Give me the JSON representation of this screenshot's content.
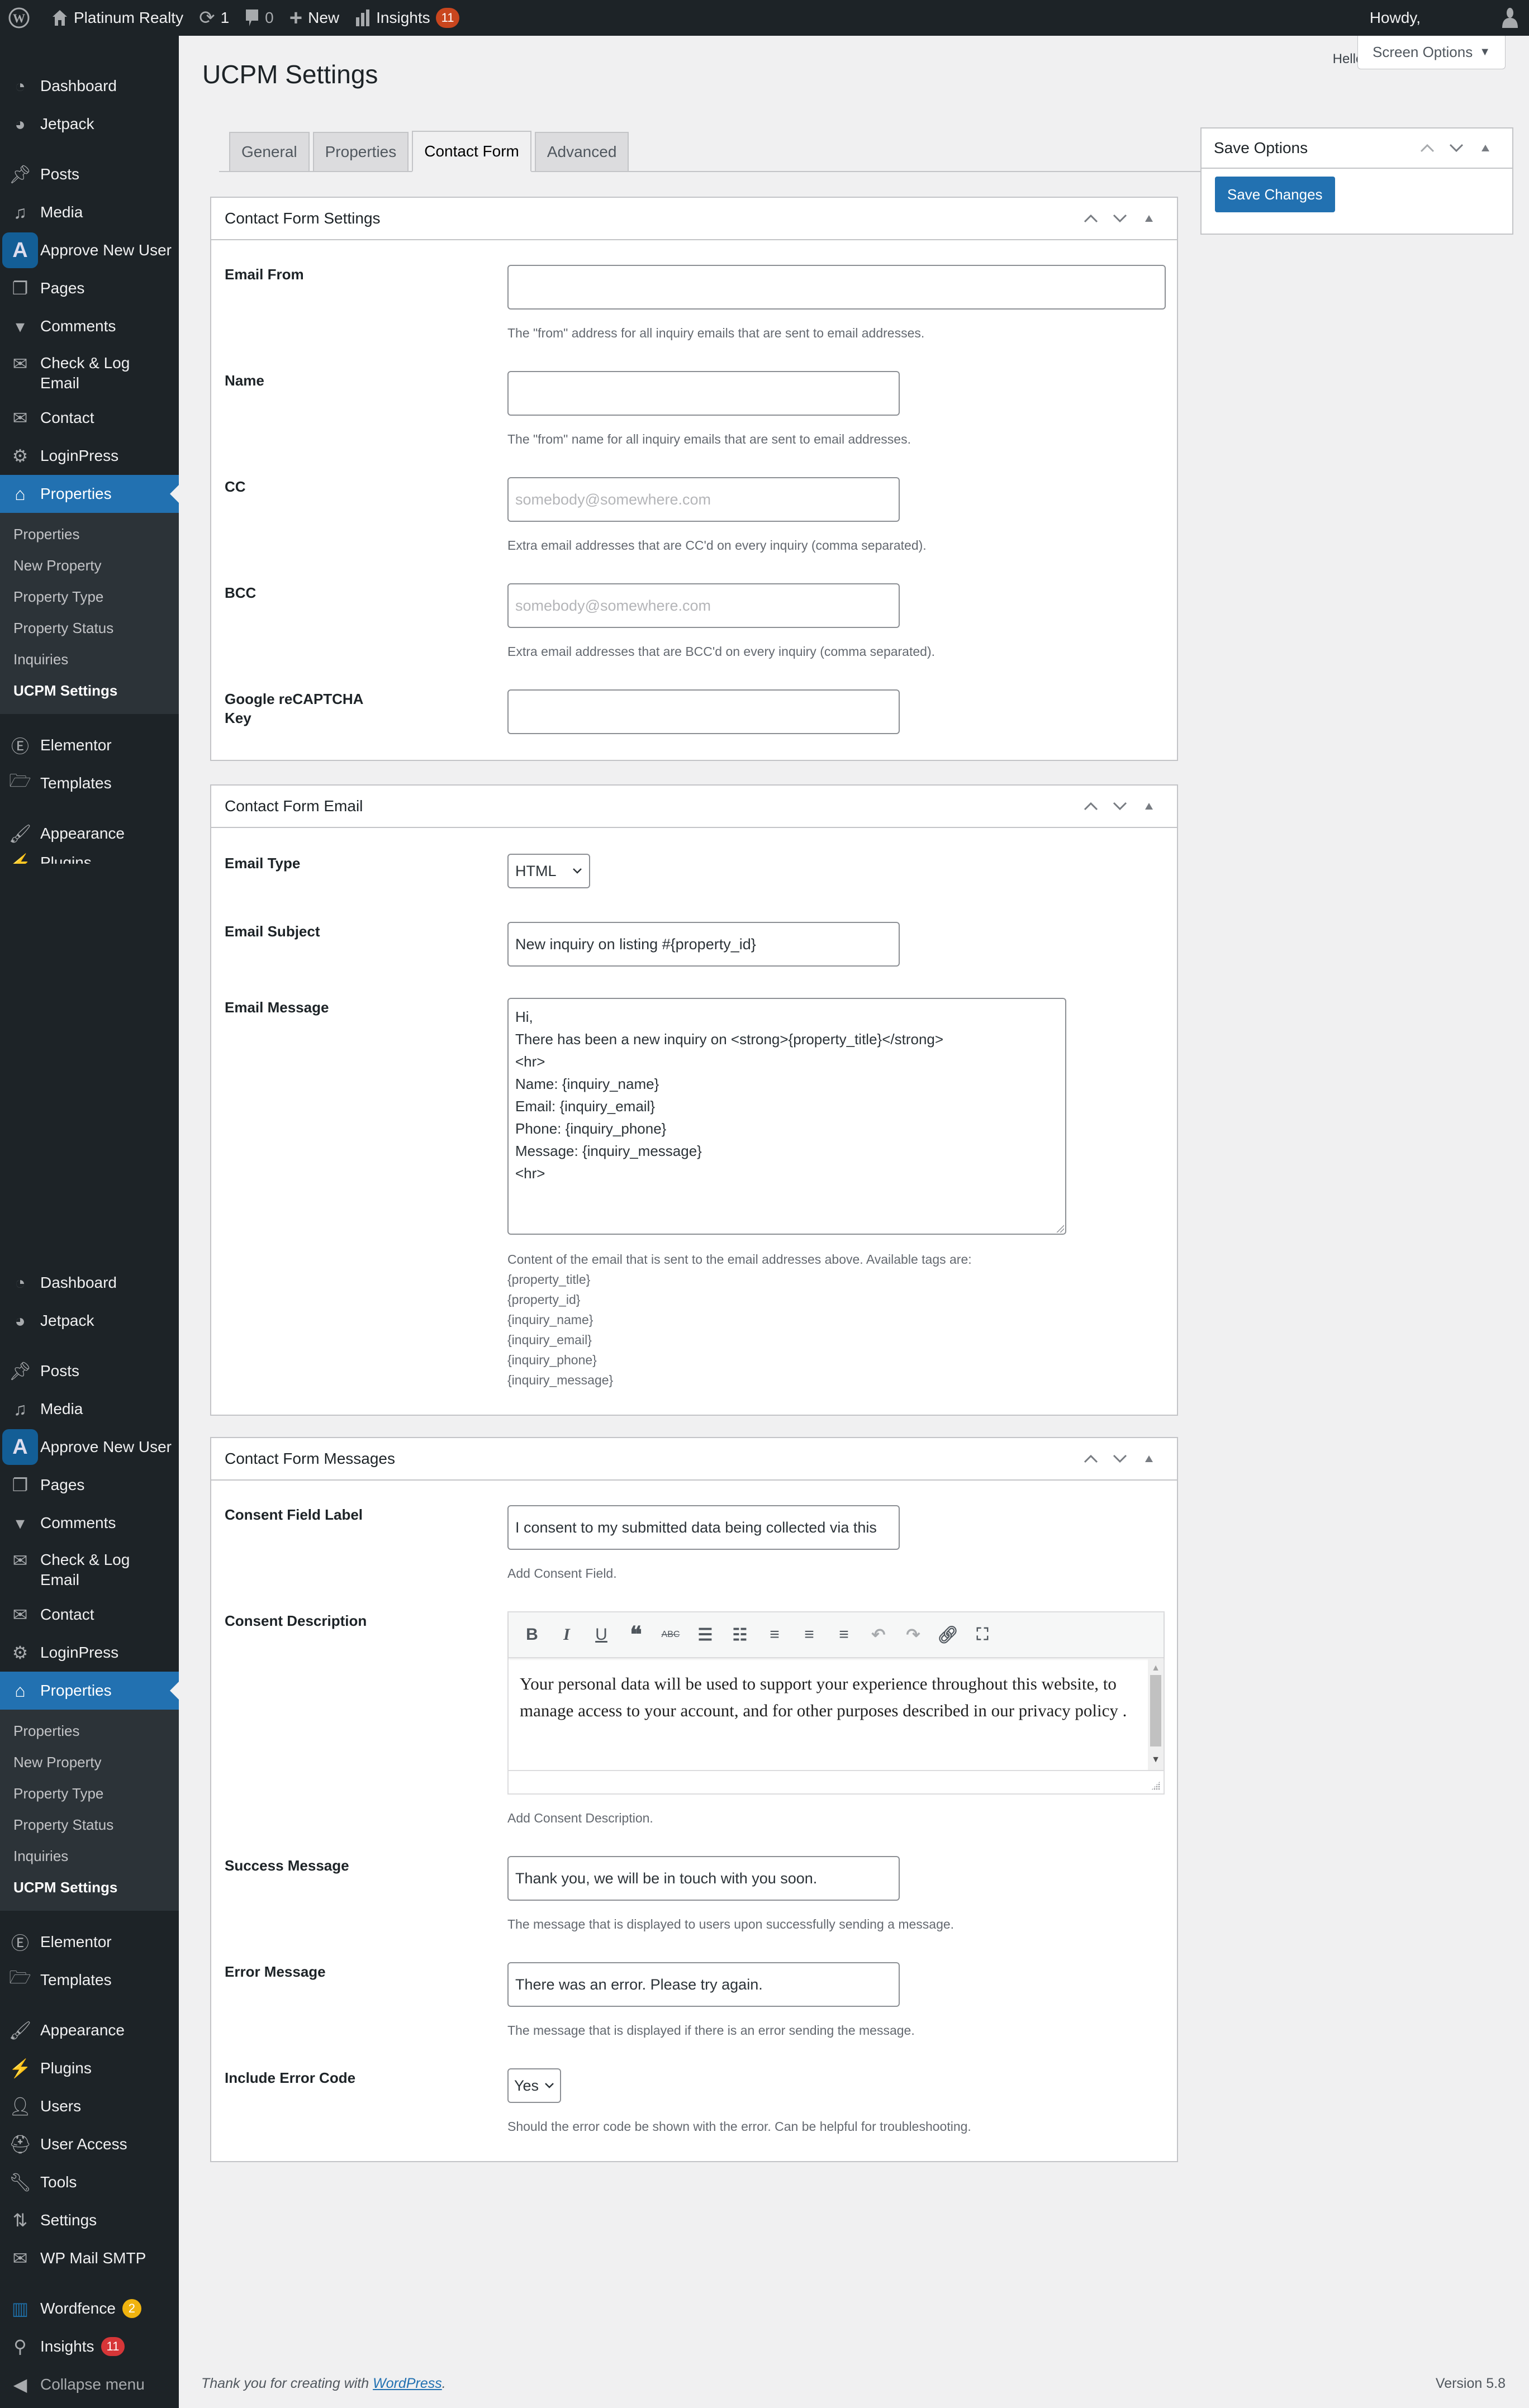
{
  "admin_bar": {
    "site_name": "Platinum Realty",
    "updates_count": "1",
    "comments_count": "0",
    "new_label": "New",
    "insights_label": "Insights",
    "insights_badge": "11",
    "howdy": "Howdy,"
  },
  "sidebar_top": {
    "items": [
      {
        "label": "Dashboard",
        "icon": "dashboard-icon"
      },
      {
        "label": "Jetpack",
        "icon": "jetpack-icon"
      },
      {
        "label": "Posts",
        "icon": "pin-icon"
      },
      {
        "label": "Media",
        "icon": "media-icon"
      },
      {
        "label": "Approve New User",
        "icon": "approve-user-icon"
      },
      {
        "label": "Pages",
        "icon": "pages-icon"
      },
      {
        "label": "Comments",
        "icon": "comment-icon"
      },
      {
        "label": "Check & Log Email",
        "icon": "envelope-open-icon"
      },
      {
        "label": "Contact",
        "icon": "envelope-icon"
      },
      {
        "label": "LoginPress",
        "icon": "loginpress-icon"
      },
      {
        "label": "Properties",
        "icon": "houses-icon"
      }
    ],
    "submenu": [
      "Properties",
      "New Property",
      "Property Type",
      "Property Status",
      "Inquiries",
      "UCPM Settings"
    ],
    "after": [
      {
        "label": "Elementor",
        "icon": "elementor-icon"
      },
      {
        "label": "Templates",
        "icon": "folder-icon"
      },
      {
        "label": "Appearance",
        "icon": "paintbrush-icon"
      },
      {
        "label": "Plugins",
        "icon": "plugin-icon"
      }
    ]
  },
  "sidebar_bottom": {
    "items": [
      {
        "label": "Dashboard"
      },
      {
        "label": "Jetpack"
      },
      {
        "label": "Posts"
      },
      {
        "label": "Media"
      },
      {
        "label": "Approve New User"
      },
      {
        "label": "Pages"
      },
      {
        "label": "Comments"
      },
      {
        "label": "Check & Log Email"
      },
      {
        "label": "Contact"
      },
      {
        "label": "LoginPress"
      },
      {
        "label": "Properties"
      }
    ],
    "submenu": [
      "Properties",
      "New Property",
      "Property Type",
      "Property Status",
      "Inquiries",
      "UCPM Settings"
    ],
    "after": [
      {
        "label": "Elementor"
      },
      {
        "label": "Templates"
      },
      {
        "label": "Appearance"
      },
      {
        "label": "Plugins"
      },
      {
        "label": "Users"
      },
      {
        "label": "User Access"
      },
      {
        "label": "Tools"
      },
      {
        "label": "Settings"
      },
      {
        "label": "WP Mail SMTP"
      },
      {
        "label": "Wordfence",
        "badge": "2"
      },
      {
        "label": "Insights",
        "badge": "11"
      },
      {
        "label": "Collapse menu"
      }
    ]
  },
  "header": {
    "page_title": "UCPM Settings",
    "hello": "Hello, Dolly",
    "screen_options": "Screen Options"
  },
  "tabs": [
    {
      "label": "General",
      "active": false
    },
    {
      "label": "Properties",
      "active": false
    },
    {
      "label": "Contact Form",
      "active": true
    },
    {
      "label": "Advanced",
      "active": false
    }
  ],
  "settings_box": {
    "title": "Contact Form Settings",
    "fields": {
      "email_from": {
        "label": "Email From",
        "value": "",
        "desc": "The \"from\" address for all inquiry emails that are sent to email addresses."
      },
      "name": {
        "label": "Name",
        "value": "",
        "desc": "The \"from\" name for all inquiry emails that are sent to email addresses."
      },
      "cc": {
        "label": "CC",
        "placeholder": "somebody@somewhere.com",
        "desc": "Extra email addresses that are CC'd on every inquiry (comma separated)."
      },
      "bcc": {
        "label": "BCC",
        "placeholder": "somebody@somewhere.com",
        "desc": "Extra email addresses that are BCC'd on every inquiry (comma separated)."
      },
      "recaptcha": {
        "label": "Google reCAPTCHA Key",
        "value": ""
      }
    }
  },
  "email_box": {
    "title": "Contact Form Email",
    "email_type": {
      "label": "Email Type",
      "value": "HTML"
    },
    "email_subject": {
      "label": "Email Subject",
      "value": "New inquiry on listing #{property_id}"
    },
    "email_message": {
      "label": "Email Message",
      "lines": [
        "Hi,",
        "There has been a new inquiry on <strong>{property_title}</strong>",
        "<hr>",
        "Name: {inquiry_name}",
        "Email: {inquiry_email}",
        "Phone: {inquiry_phone}",
        "Message: {inquiry_message}",
        "<hr>"
      ],
      "desc": "Content of the email that is sent to the email addresses above. Available tags are:",
      "tags": [
        "{property_title}",
        "{property_id}",
        "{inquiry_name}",
        "{inquiry_email}",
        "{inquiry_phone}",
        "{inquiry_message}"
      ]
    }
  },
  "messages_box": {
    "title": "Contact Form Messages",
    "consent_label": {
      "label": "Consent Field Label",
      "value": "I consent to my submitted data being collected via this",
      "desc": "Add Consent Field."
    },
    "consent_desc": {
      "label": "Consent Description",
      "text": "Your personal data will be used to support your experience throughout this website, to manage access to your account, and for other purposes described in our privacy policy .",
      "desc": "Add Consent Description.",
      "toolbar": [
        "bold",
        "italic",
        "underline",
        "blockquote",
        "strikethrough",
        "bullet-list",
        "numbered-list",
        "align-left",
        "align-center",
        "align-right",
        "undo",
        "redo",
        "link",
        "fullscreen"
      ]
    },
    "success": {
      "label": "Success Message",
      "value": "Thank you, we will be in touch with you soon.",
      "desc": "The message that is displayed to users upon successfully sending a message."
    },
    "error": {
      "label": "Error Message",
      "value": "There was an error. Please try again.",
      "desc": "The message that is displayed if there is an error sending the message."
    },
    "error_code": {
      "label": "Include Error Code",
      "value": "Yes",
      "desc": "Should the error code be shown with the error. Can be helpful for troubleshooting."
    }
  },
  "save_box": {
    "title": "Save Options",
    "button": "Save Changes"
  },
  "footer": {
    "thanks": "Thank you for creating with ",
    "link": "WordPress",
    "version": "Version 5.8"
  },
  "colors": {
    "accent": "#2271b1",
    "adminbar": "#1d2327",
    "badge_red": "#d63638",
    "badge_orange": "#f0b30f"
  }
}
